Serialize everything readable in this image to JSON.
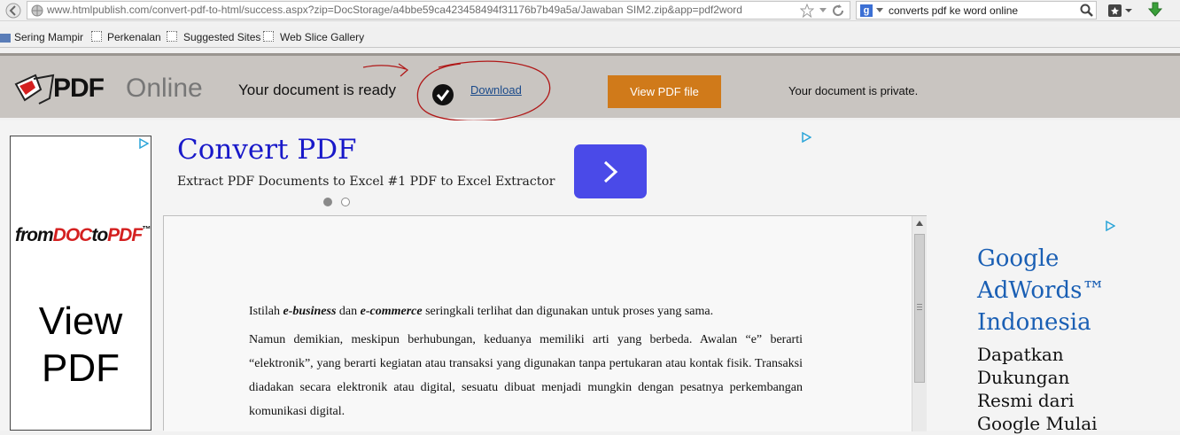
{
  "browser": {
    "url": "www.htmlpublish.com/convert-pdf-to-html/success.aspx?zip=DocStorage/a4bbe59ca423458494f31176b7b49a5a/Jawaban SIM2.zip&app=pdf2word",
    "search_query": "converts pdf ke word online",
    "bookmarks": [
      "Sering Mampir",
      "Perkenalan",
      "Suggested Sites",
      "Web Slice Gallery"
    ]
  },
  "header": {
    "logo_part1": "PDF",
    "logo_part2": "Online",
    "ready_text": "Your document is ready",
    "download_label": "Download",
    "view_pdf_label": "View PDF file",
    "private_text": "Your document is private."
  },
  "left_ad": {
    "logo_from": "from",
    "logo_doc": "DOC",
    "logo_to": "to",
    "logo_pdf": "PDF",
    "tm": "™",
    "title": "View PDF"
  },
  "top_ad": {
    "title": "Convert PDF",
    "description": "Extract PDF Documents to Excel #1 PDF to Excel Extractor"
  },
  "document": {
    "p1_a": "Istilah ",
    "p1_b": "e-business",
    "p1_c": " dan ",
    "p1_d": "e-commerce",
    "p1_e": " seringkali terlihat dan digunakan untuk proses yang sama.",
    "p2": "Namun demikian, meskipun berhubungan, keduanya memiliki arti yang berbeda. Awalan “e” berarti “elektronik”, yang berarti kegiatan atau transaksi yang digunakan tanpa pertukaran atau kontak fisik. Transaksi diadakan secara elektronik atau digital, sesuatu dibuat menjadi mungkin dengan pesatnya perkembangan komunikasi digital."
  },
  "right_ad": {
    "title_line1": "Google",
    "title_line2": "AdWords™",
    "title_line3": "Indonesia",
    "body_line1": "Dapatkan",
    "body_line2": "Dukungan",
    "body_line3": "Resmi dari",
    "body_line4": "Google Mulai"
  },
  "colors": {
    "header_bg": "#c9c5c1",
    "view_button": "#d07a1a",
    "ad_link_blue": "#1919c9",
    "ad_button": "#4a4ae8",
    "annotation_red": "#b01818"
  }
}
